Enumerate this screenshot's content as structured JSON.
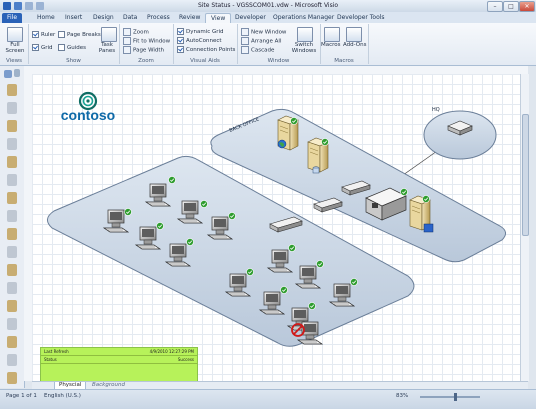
{
  "window": {
    "title": "Site Status - VGSSCOM01.vdw - Microsoft Visio",
    "min": "–",
    "max": "□",
    "close": "✕"
  },
  "tabs": [
    "File",
    "Home",
    "Insert",
    "Design",
    "Data",
    "Process",
    "Review",
    "View",
    "Developer",
    "Operations Manager",
    "Developer Tools"
  ],
  "ribbon": {
    "views": {
      "full_screen": "Full Screen",
      "label": "Views"
    },
    "show": {
      "ruler": "Ruler",
      "page_breaks": "Page Breaks",
      "grid": "Grid",
      "guides": "Guides",
      "task_panes": "Task Panes",
      "label": "Show"
    },
    "zoom": {
      "zoom": "Zoom",
      "fit_to_window": "Fit to Window",
      "page_width": "Page Width",
      "label": "Zoom"
    },
    "visual_aids": {
      "dynamic_grid": "Dynamic Grid",
      "autoconnect": "AutoConnect",
      "connection_points": "Connection Points",
      "label": "Visual Aids"
    },
    "window": {
      "new_window": "New Window",
      "arrange_all": "Arrange All",
      "cascade": "Cascade",
      "switch_windows": "Switch Windows",
      "label": "Window"
    },
    "macros": {
      "macros": "Macros",
      "add_ons": "Add-Ons",
      "label": "Macros"
    }
  },
  "diagram": {
    "logo": "contoso",
    "back_office": "BACK OFFICE",
    "hq": "HQ",
    "info": [
      {
        "k": "Last Refresh",
        "v": "4/9/2010 12:27:29 PM"
      },
      {
        "k": "Status",
        "v": "Success"
      }
    ]
  },
  "pages": [
    "Physcial",
    "Background"
  ],
  "status": {
    "page": "Page 1 of 1",
    "language": "English (U.S.)",
    "zoom": "83%"
  }
}
